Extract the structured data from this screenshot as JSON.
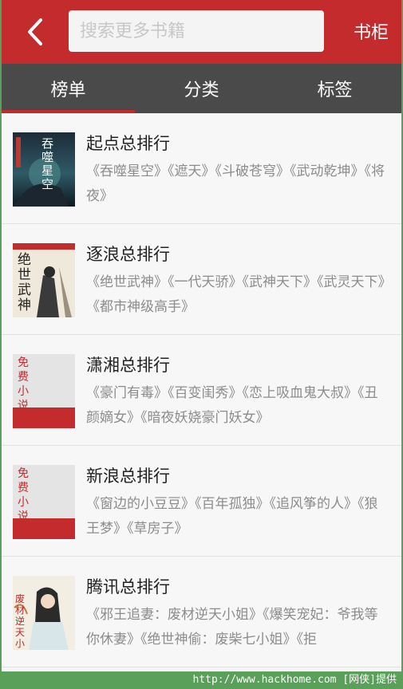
{
  "header": {
    "search_placeholder": "搜索更多书籍",
    "shelf_label": "书柜"
  },
  "tabs": [
    {
      "label": "榜单",
      "active": true
    },
    {
      "label": "分类",
      "active": false
    },
    {
      "label": "标签",
      "active": false
    }
  ],
  "rankings": [
    {
      "title": "起点总排行",
      "books": "《吞噬星空》《遮天》《斗破苍穹》《武动乾坤》《将夜》",
      "cover_text": "吞噬星空"
    },
    {
      "title": "逐浪总排行",
      "books": "《绝世武神》《一代天骄》《武神天下》《武灵天下》《都市神级高手》",
      "cover_text": "绝世武神"
    },
    {
      "title": "潇湘总排行",
      "books": "《豪门有毒》《百变闺秀》《恋上吸血鬼大叔》《丑颜嫡女》《暗夜妖娆豪门妖女》",
      "cover_text": "免费小说"
    },
    {
      "title": "新浪总排行",
      "books": "《窗边的小豆豆》《百年孤独》《追风筝的人》《狼王梦》《草房子》",
      "cover_text": "免费小说"
    },
    {
      "title": "腾讯总排行",
      "books": "《邪王追妻：废材逆天小姐》《爆笑宠妃：爷我等你休妻》《绝世神偷：废柴七小姐》《拒",
      "cover_text": "废材逆天小姐"
    }
  ],
  "watermark": "http://www.hackhome.com [网侠]提供",
  "colors": {
    "accent": "#c32b2d",
    "tabbar": "#4a4a4a",
    "list_bg": "#f7f7f7"
  }
}
